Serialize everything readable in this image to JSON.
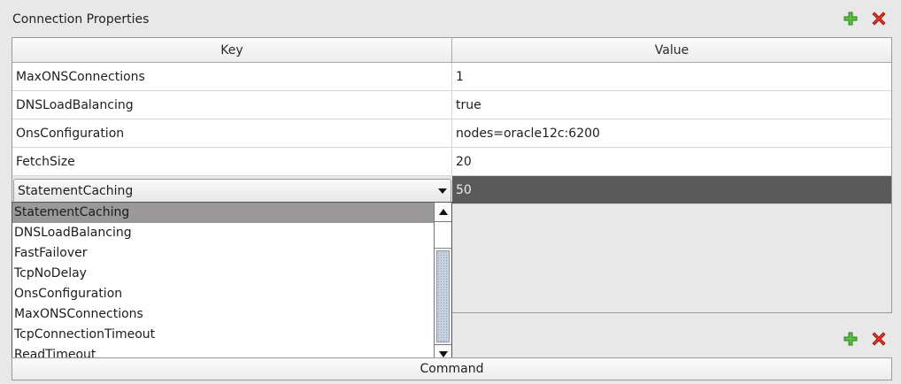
{
  "panel": {
    "title": "Connection Properties",
    "add_icon": "plus-icon",
    "remove_icon": "x-icon"
  },
  "table": {
    "columns": [
      "Key",
      "Value"
    ],
    "rows": [
      {
        "key": "MaxONSConnections",
        "value": "1"
      },
      {
        "key": "DNSLoadBalancing",
        "value": "true"
      },
      {
        "key": "OnsConfiguration",
        "value": "nodes=oracle12c:6200"
      },
      {
        "key": "FetchSize",
        "value": "20"
      }
    ],
    "editing_row": {
      "key": "StatementCaching",
      "value": "50"
    }
  },
  "dropdown": {
    "items": [
      "StatementCaching",
      "DNSLoadBalancing",
      "FastFailover",
      "TcpNoDelay",
      "OnsConfiguration",
      "MaxONSConnections",
      "TcpConnectionTimeout",
      "ReadTimeout"
    ],
    "selected_index": 0
  },
  "commands_panel": {
    "column": "Command"
  },
  "colors": {
    "add": "#4caf3a",
    "remove": "#d9251c",
    "selected_row": "#5a5a5a"
  }
}
